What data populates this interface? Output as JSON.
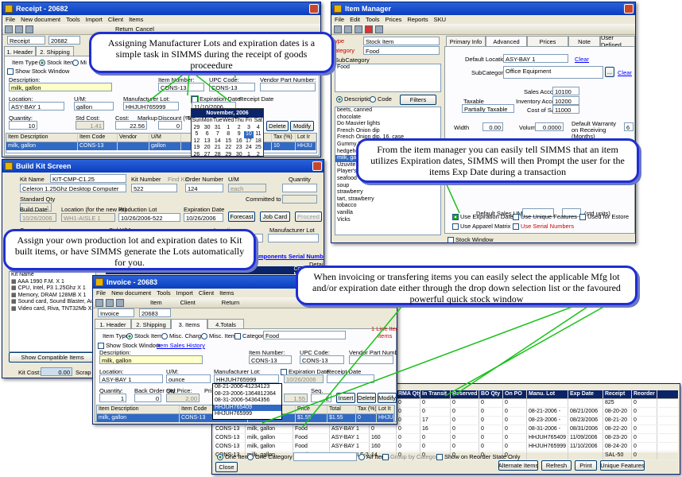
{
  "receipt": {
    "title": "Receipt - 20682",
    "menu": [
      "File",
      "New document",
      "Tools",
      "Import",
      "Client",
      "Items"
    ],
    "doc_type": "Receipt",
    "doc_no": "20682",
    "tabs": [
      "1. Header",
      "2. Shipping"
    ],
    "item_type_label": "Item Type",
    "item_type_stock": "Stock Item",
    "item_type_misc": "Mi",
    "show_stock": "Show Stock Window",
    "desc_label": "Description:",
    "desc_value": "milk, gallon",
    "item_no_label": "Item Number:",
    "item_no": "CONS-13",
    "upc_label": "UPC Code:",
    "upc": "CONS-13",
    "vendor_part_label": "Vendor Part Number:",
    "location_label": "Location:",
    "location": "ASY-BAY 1",
    "um_label": "U/M:",
    "um": "gallon",
    "mfg_lot_label": "Manufacturer Lot:",
    "mfg_lot": "HHJUH765999",
    "exp_label": "Expiration Date:",
    "exp_value": "11/10/2006",
    "receipt_date_label": "Receipt Date",
    "qty_label": "Quantity:",
    "qty": "10",
    "std_cost_label": "Std Cost:",
    "std_cost": "1.41",
    "cost_label": "Cost:",
    "markup_label": "Markup",
    "cost": "22.56",
    "discount_label": "Discount (%)",
    "discount": "0",
    "total_label": "Tota",
    "delete": "Delete",
    "modify": "Modify",
    "grid_headers": [
      "Item Description",
      "Item Code",
      "Vendor",
      "U/M",
      "",
      "Tax (%)",
      "Lot Ir"
    ],
    "grid_row": [
      "milk, gallon",
      "CONS-13",
      "",
      "gallon",
      "",
      "10",
      "HHJU"
    ],
    "return": "Return",
    "cancel": "Cancel"
  },
  "calendar": {
    "month": "November, 2006",
    "days": [
      "Sun",
      "Mon",
      "Tue",
      "Wed",
      "Thu",
      "Fri",
      "Sat"
    ],
    "weeks": [
      [
        "29",
        "30",
        "31",
        "1",
        "2",
        "3",
        "4"
      ],
      [
        "5",
        "6",
        "7",
        "8",
        "9",
        "10",
        "11"
      ],
      [
        "12",
        "13",
        "14",
        "15",
        "16",
        "17",
        "18"
      ],
      [
        "19",
        "20",
        "21",
        "22",
        "23",
        "24",
        "25"
      ],
      [
        "26",
        "27",
        "28",
        "29",
        "30",
        "1",
        "2"
      ]
    ]
  },
  "item_manager": {
    "title": "Item Manager",
    "menu": [
      "File",
      "Edit",
      "Tools",
      "Prices",
      "Reports",
      "SKU"
    ],
    "type_label": "ype",
    "type_value": "Stock Item",
    "cat_label": "ategory",
    "cat_value": "Food",
    "subcat_label": "SubCategory",
    "subcat_item": "Food",
    "desc": "Description",
    "code": "Code",
    "filters": "Filters",
    "list": [
      "beets, canned",
      "chocolate",
      "Do Mauvier lights",
      "French Onion dip",
      "French Onion dip, 16. case",
      "Gummy Bears",
      "hedgehogs, Nestles",
      "milk, gallon",
      "Uzuvite",
      "Player's Medium",
      "seafood",
      "soup",
      "strawberry",
      "tart, strawberry",
      "tobacco",
      "vanilla",
      "Vicks"
    ],
    "tabs": [
      "Primary Info",
      "Advanced",
      "Prices",
      "Note",
      "User Defined"
    ],
    "default_loc_label": "Default Location",
    "default_loc": "ASY-BAY 1",
    "clear": "Clear",
    "subcategory_label": "SubCategory",
    "subcategory": "Office Equipment",
    "sales_acct_label": "Sales Account",
    "sales_acct": "10100",
    "taxable_label": "Taxable",
    "taxable": "Partially Taxable",
    "inv_acct_label": "Inventory Account",
    "inv_acct": "10200",
    "cogs_label": "Cost of Sales",
    "cogs": "11000",
    "width_label": "Width",
    "width": "0.00",
    "volume_label": "Volume",
    "volume": "0.0000",
    "warranty_label": "Default Warranty on Receiving (Months)",
    "warranty": "6",
    "sales_um_label": "Default Sales UM",
    "std_units": "(std units)",
    "chk_use_exp": "Use Expiration Dates",
    "chk_unique": "Use Unique Features",
    "chk_estore": "Used for Estore",
    "chk_apparel": "Use Apparel Matrix",
    "chk_serial": "Use Serial Numbers",
    "stock_window": "Stock Window"
  },
  "build_kit": {
    "title": "Build Kit Screen",
    "kit_name_label": "Kit Name",
    "kit_name": "KIT-CMP-C1.25",
    "kit_desc": "Celeron 1.25Ghz Desktop Computer",
    "kit_number_label": "Kit Number",
    "kit_number": "522",
    "find_kit": "Find Kit",
    "order_label": "Order Number",
    "order_no": "124",
    "um_label": "U/M",
    "um": "each",
    "qty_label": "Quantity",
    "std_qty_label": "Standard Qty",
    "std_qty": "1",
    "committed_label": "Committed to Stock",
    "build_date_label": "Build Date",
    "build_date": "10/26/2006",
    "loc_label": "Location (for the new kit)",
    "loc": "WH1-AISLE 1",
    "prod_lot_label": "Production Lot",
    "prod_lot": "10/26/2006-522",
    "exp_label": "Expiration Date",
    "exp": "10/26/2006",
    "forecast": "Forecast",
    "job_card": "Job Card",
    "proceed": "Proceed",
    "component_label": "Component",
    "std_um_label": "Std U/M",
    "location_label": "Location",
    "mfg_lot_label": "Manufacturer Lot",
    "components_serial": "Components Serial Number",
    "details": "Details",
    "tree": [
      "AAA 1990 F.M. X 1",
      "CPU, Intel, P3 1.25Ghz X 1",
      "Memory, DRAM 128MB X 1",
      "Sound card, Sound Blaster, Au",
      "Video card, Riva, TNT32Mb X"
    ],
    "tree_top": "Kit Name",
    "show_compatible": "Show Compatible Items",
    "kit_cost_label": "Kit Cost:",
    "kit_cost": "0.00",
    "scrap": "Scrap Va",
    "bar_location": "Location",
    "bar_cost_manuf": "Cost Manufac"
  },
  "invoice": {
    "title": "Invoice - 20683",
    "menu": [
      "File",
      "New document",
      "Tools",
      "Import",
      "Client",
      "Items"
    ],
    "doc_type": "Invoice",
    "doc_no": "20683",
    "tabs": [
      "1. Header",
      "2. Shipping",
      "3. Items",
      "4.Totals"
    ],
    "item_type_label": "Item Type",
    "stock": "Stock Item",
    "misc_charge": "Misc. Charge",
    "misc_item": "Misc. Item",
    "category_label": "Category:",
    "category": "Food",
    "line_no": "1 Line Iter",
    "items_note": "Items",
    "show_stock": "Show Stock Window",
    "item_sales_history": "Item Sales History",
    "desc_label": "Description:",
    "desc": "milk, gallon",
    "item_no_label": "Item Number:",
    "item_no": "CONS-13",
    "upc_label": "UPC Code:",
    "upc": "CONS-13",
    "vendor_label": "Vendor Part Number:",
    "loc_label": "Location:",
    "loc": "ASY-BAY 1",
    "um_label": "U/M:",
    "um": "ounce",
    "mfg_label": "Manufacturer Lot:",
    "mfg": "HHJUH765999",
    "exp_label": "Expiration Date:",
    "exp": "10/26/2006",
    "receipt_label": "Receipt Date",
    "qty_label": "Quantity:",
    "qty": "1",
    "backorder_label": "Back Order Qty.",
    "backorder": "0",
    "std_price_label": "Std Price:",
    "std_price": "2.00",
    "pri_label": "Pri",
    "seq_label": "Seq.",
    "seq": "2",
    "tax_value": "1.55",
    "insert": "Insert",
    "delete": "Delete",
    "modify": "Modify",
    "lot_options": [
      "08-21-2006-41234123",
      "08-23-2006-1364812364",
      "08-31-2006-54364356",
      "HHJUH765409",
      "HHJUH765999"
    ],
    "grid_headers": [
      "Item Description",
      "Item Code",
      "U/M",
      "Price",
      "Total",
      "Tax (%)",
      "Lot It"
    ],
    "grid_row": [
      "milk, gallon",
      "CONS-13",
      "ounce",
      "$1.55",
      "$1.55",
      "0",
      "HHJU"
    ],
    "item_btn": "Item",
    "client_btn": "Client",
    "return": "Return"
  },
  "stock": {
    "headers": [
      "Item Code",
      "Item Description",
      "Item Category",
      "Location",
      "On Hold",
      "RMA Qty",
      "In Transit",
      "Reserved",
      "BO Qty",
      "On PO",
      "Manu. Lot",
      "Exp Date",
      "Receipt",
      "Reorder"
    ],
    "rows": [
      [
        "CONS-13",
        "milk, gallon",
        "Food",
        "ASY-BAY 1",
        "0",
        "0",
        "0",
        "0",
        "0",
        "0",
        "",
        "",
        "825",
        "0"
      ],
      [
        "CONS-13",
        "milk, gallon",
        "Food",
        "ASY-BAY 1",
        "0",
        "0",
        "0",
        "0",
        "0",
        "0",
        "08-21-2006 -",
        "08/21/2006",
        "08-20-20",
        "0"
      ],
      [
        "CONS-13",
        "milk, gallon",
        "Food",
        "ASY-BAY 1",
        "0",
        "0",
        "17",
        "0",
        "0",
        "0",
        "08-23-2006 -",
        "08/23/2006",
        "08-21-20",
        "0"
      ],
      [
        "CONS-13",
        "milk, gallon",
        "Food",
        "ASY-BAY 1",
        "0",
        "0",
        "16",
        "0",
        "0",
        "0",
        "08-31-2006 -",
        "08/31/2006",
        "08-22-20",
        "0"
      ],
      [
        "CONS-13",
        "milk, gallon",
        "Food",
        "ASY-BAY 1",
        "160",
        "0",
        "0",
        "0",
        "0",
        "0",
        "HHJUH765409",
        "11/09/2006",
        "08-23-20",
        "0"
      ],
      [
        "CONS-13",
        "milk, gallon",
        "Food",
        "ASY-BAY 1",
        "160",
        "0",
        "0",
        "0",
        "0",
        "0",
        "HHJUH765999",
        "11/10/2006",
        "08-24-20",
        "0"
      ],
      [
        "CONS-13",
        "milk, gallon",
        "Food",
        "WH1-SHELF-2",
        "14",
        "0",
        "0",
        "0",
        "0",
        "0",
        "",
        "",
        "SAL-50",
        "0"
      ]
    ],
    "one_item": "One Item",
    "one_category": "One Category",
    "all_items": "All Items",
    "group_by": "Group by Category",
    "reorder_only": "Show on Reorder State Only",
    "alt_items": "Alternate Items",
    "refresh": "Refresh",
    "print": "Print",
    "unique": "Unique Features",
    "close": "Close"
  },
  "callouts": {
    "c1": "Assigning Manufacturer Lots and expiration dates is a simple task in SIMMS during the receipt of goods proceedure",
    "c2": "From the item manager you can easily tell SIMMS that an item utilizes Expiration dates, SIMMS will then Prompt the user for the items Exp Date during a transaction",
    "c3": "Assign your own production lot and expiration dates to Kit built items, or have SIMMS generate the Lots automatically for you.",
    "c4": "When invoicing or transfering items you can easily select the applicable Mfg lot and/or expiration date either through the drop down selection list or the favoured powerful quick stock window"
  },
  "colors": {
    "callout_border": "#1e2fd0",
    "connector": "#18c018",
    "titlebar": "#0a3dbf"
  }
}
